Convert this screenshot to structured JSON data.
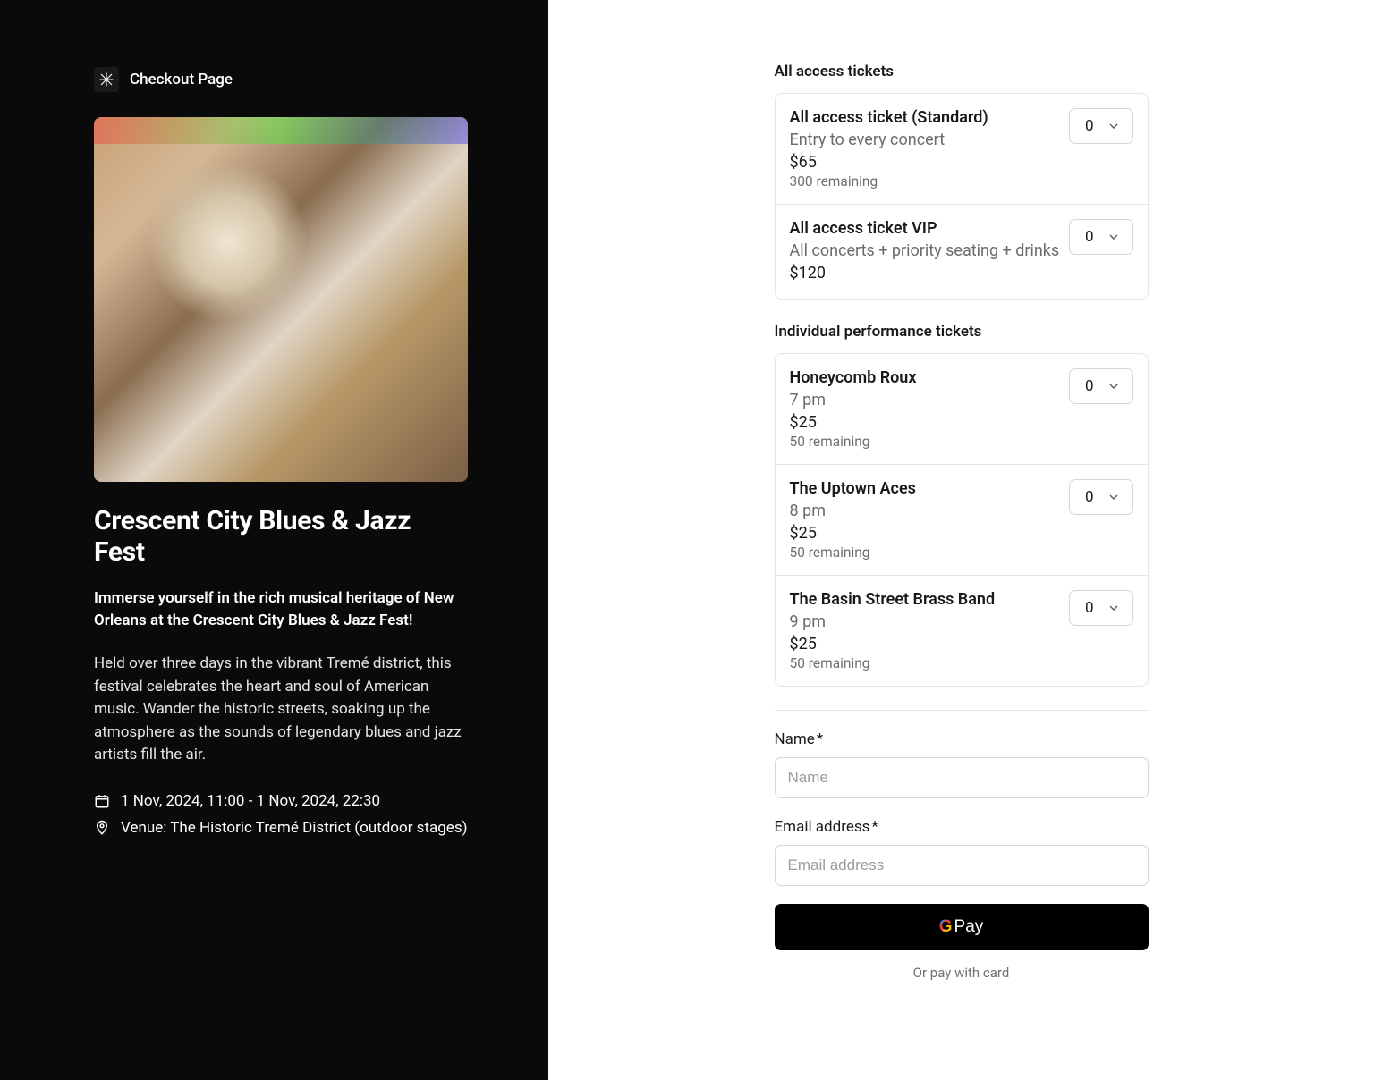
{
  "brand": {
    "name": "Checkout Page"
  },
  "event": {
    "title": "Crescent City Blues & Jazz Fest",
    "intro": "Immerse yourself in the rich musical heritage of New Orleans at the Crescent City Blues & Jazz Fest!",
    "description": "Held over three days in the vibrant Tremé district, this festival celebrates the heart and soul of American music. Wander the historic streets, soaking up the atmosphere as the sounds of legendary blues and jazz artists fill the air.",
    "datetime": "1 Nov, 2024, 11:00 - 1 Nov, 2024, 22:30",
    "venue": "Venue: The Historic Tremé District (outdoor stages)"
  },
  "sections": {
    "all_access_title": "All access tickets",
    "individual_title": "Individual performance tickets"
  },
  "tickets": {
    "all_access": [
      {
        "name": "All access ticket (Standard)",
        "sub": "Entry to every concert",
        "price": "$65",
        "remaining": "300 remaining",
        "qty": "0"
      },
      {
        "name": "All access ticket VIP",
        "sub": "All concerts + priority seating + drinks",
        "price": "$120",
        "remaining": "",
        "qty": "0"
      }
    ],
    "individual": [
      {
        "name": "Honeycomb Roux",
        "sub": "7 pm",
        "price": "$25",
        "remaining": "50 remaining",
        "qty": "0"
      },
      {
        "name": "The Uptown Aces",
        "sub": "8 pm",
        "price": "$25",
        "remaining": "50 remaining",
        "qty": "0"
      },
      {
        "name": "The Basin Street Brass Band",
        "sub": "9 pm",
        "price": "$25",
        "remaining": "50 remaining",
        "qty": "0"
      }
    ]
  },
  "form": {
    "name_label": "Name",
    "name_placeholder": "Name",
    "email_label": "Email address",
    "email_placeholder": "Email address",
    "required_mark": "*",
    "gpay_text": "Pay",
    "or_pay": "Or pay with card"
  }
}
